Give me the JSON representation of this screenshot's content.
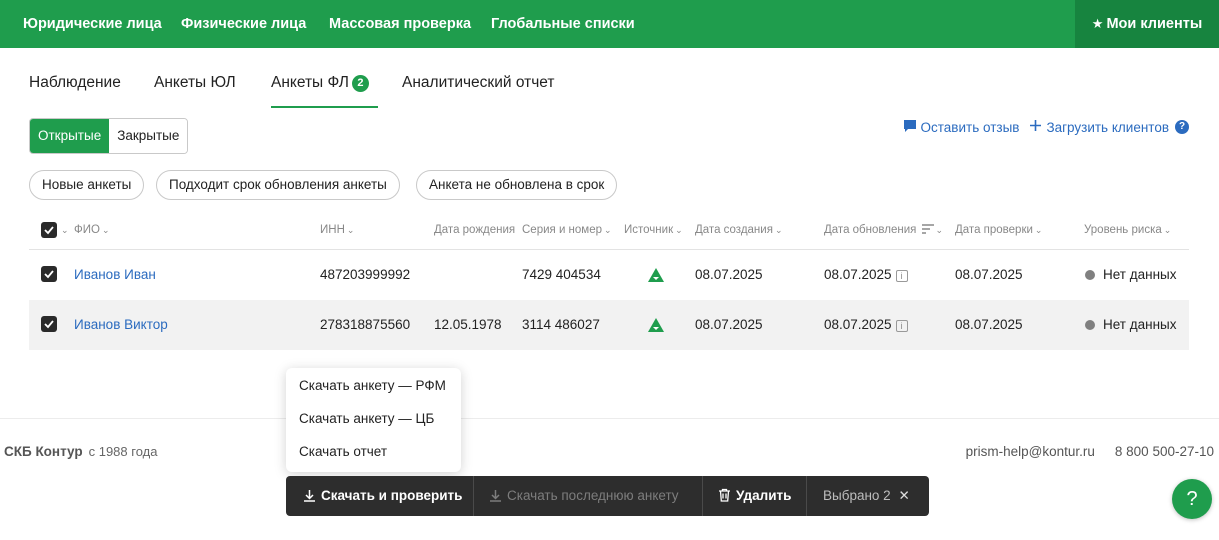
{
  "topnav": {
    "items": [
      "Юридические лица",
      "Физические лица",
      "Массовая проверка",
      "Глобальные списки"
    ],
    "my_clients": "Мои клиенты"
  },
  "tabs": [
    {
      "label": "Наблюдение"
    },
    {
      "label": "Анкеты ЮЛ"
    },
    {
      "label": "Анкеты ФЛ",
      "badge": "2",
      "active": true
    },
    {
      "label": "Аналитический отчет"
    }
  ],
  "status_toggle": {
    "open": "Открытые",
    "closed": "Закрытые",
    "selected": "Открытые"
  },
  "links": {
    "feedback": "Оставить отзыв",
    "upload": "Загрузить клиентов"
  },
  "filters": [
    "Новые анкеты",
    "Подходит срок обновления анкеты",
    "Анкета не обновлена в срок"
  ],
  "table": {
    "columns": [
      "ФИО",
      "ИНН",
      "Дата рождения",
      "Серия и номер",
      "Источник",
      "Дата создания",
      "Дата обновления",
      "Дата проверки",
      "Уровень риска"
    ],
    "rows": [
      {
        "checked": true,
        "name": "Иванов Иван",
        "inn": "487203999992",
        "birth": "",
        "passport": "7429 404534",
        "source_icon": "triangle-source-icon",
        "created": "08.07.2025",
        "updated": "08.07.2025",
        "checked_date": "08.07.2025",
        "risk": "Нет данных"
      },
      {
        "checked": true,
        "name": "Иванов Виктор",
        "inn": "278318875560",
        "birth": "12.05.1978",
        "passport": "3114 486027",
        "source_icon": "triangle-source-icon",
        "created": "08.07.2025",
        "updated": "08.07.2025",
        "checked_date": "08.07.2025",
        "risk": "Нет данных"
      }
    ]
  },
  "footer": {
    "company": "СКБ Контур",
    "since": "с 1988 года",
    "email": "prism-help@kontur.ru",
    "phone": "8 800 500-27-10"
  },
  "download_menu": [
    "Скачать анкету — РФМ",
    "Скачать анкету — ЦБ",
    "Скачать отчет"
  ],
  "action_bar": {
    "download_check": "Скачать и проверить",
    "download_last": "Скачать последнюю анкету",
    "delete": "Удалить",
    "selected": "Выбрано 2"
  },
  "help_fab": "?",
  "colors": {
    "brand": "#1f9d4d",
    "link": "#2b6bbf",
    "action_bar": "#2d2d2d"
  }
}
